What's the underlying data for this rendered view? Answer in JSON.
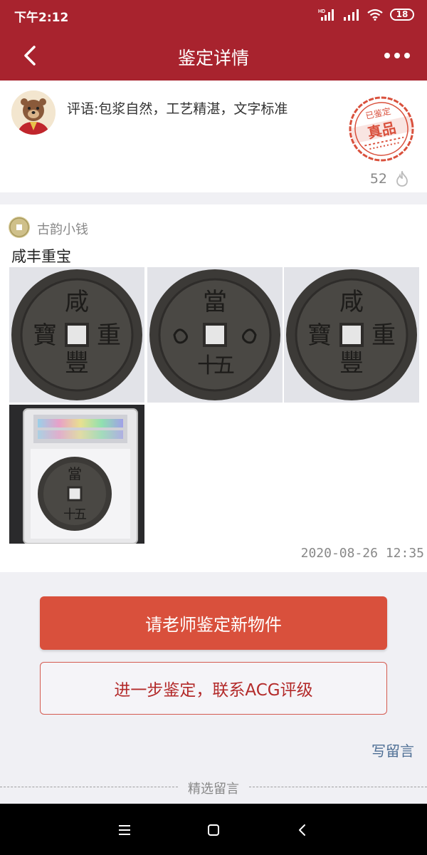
{
  "status_bar": {
    "time": "下午2:12",
    "battery": "18"
  },
  "header": {
    "title": "鉴定详情"
  },
  "comment": {
    "text": "评语:包浆自然，工艺精湛，文字标准",
    "likes": "52",
    "seal_top": "已鉴定",
    "seal_main": "真品"
  },
  "post": {
    "author": "古韵小钱",
    "title": "咸丰重宝",
    "timestamp": "2020-08-26 12:35",
    "photos": [
      {
        "type": "coin-obverse",
        "characters": [
          "咸",
          "豐",
          "重",
          "寶"
        ]
      },
      {
        "type": "coin-reverse",
        "characters": [
          "當",
          "五",
          "十"
        ]
      },
      {
        "type": "coin-obverse",
        "characters": [
          "咸",
          "豐",
          "重",
          "寶"
        ]
      },
      {
        "type": "graded-slab",
        "characters": [
          "當",
          "五",
          "十"
        ]
      }
    ]
  },
  "actions": {
    "primary": "请老师鉴定新物件",
    "secondary": "进一步鉴定，联系ACG评级",
    "write_comment": "写留言",
    "selected_comments": "精选留言"
  },
  "colors": {
    "brand_red": "#a8232e",
    "button_red": "#d9503c",
    "link_blue": "#4d6e94"
  }
}
